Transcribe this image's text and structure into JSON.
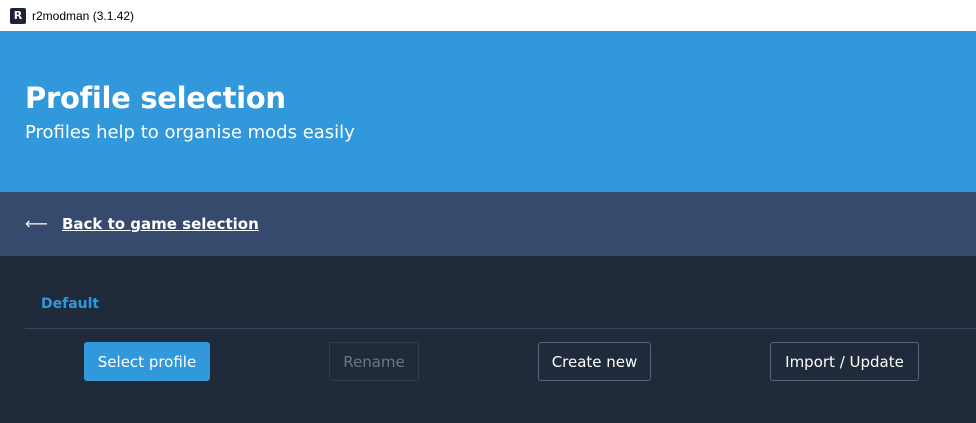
{
  "window": {
    "title": "r2modman (3.1.42)",
    "logo_letter": "R"
  },
  "hero": {
    "title": "Profile selection",
    "subtitle": "Profiles help to organise mods easily",
    "background_color": "#3298dc"
  },
  "navigation": {
    "back_icon": "left-arrow-icon",
    "back_glyph": "⟵",
    "back_label": "Back to game selection"
  },
  "profiles": {
    "items": [
      {
        "name": "Default",
        "selected": true
      }
    ]
  },
  "actions": {
    "select_profile": "Select profile",
    "rename": "Rename",
    "create_new": "Create new",
    "import_update": "Import / Update"
  },
  "colors": {
    "accent": "#3298dc",
    "nav_bar": "#364a6e",
    "background": "#1f2a3a"
  }
}
